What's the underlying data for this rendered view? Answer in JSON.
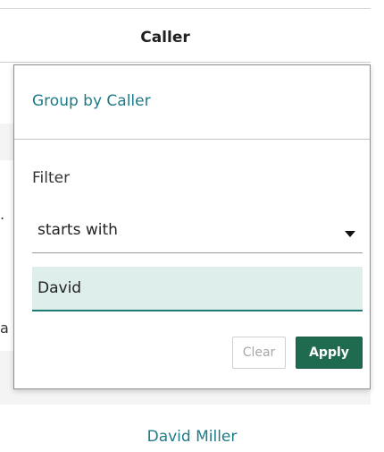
{
  "table": {
    "column_header": "Caller",
    "edge_glyph_dot": ".",
    "edge_glyph_a": "a",
    "visible_value_link": "David Miller"
  },
  "popover": {
    "title": "Group by Caller",
    "filter_label": "Filter",
    "condition": {
      "selected": "starts with",
      "icon": "caret-down-icon"
    },
    "input_value": "David",
    "clear_label": "Clear",
    "apply_label": "Apply"
  },
  "colors": {
    "link_teal": "#1d7a87",
    "input_fill": "#deeeeb",
    "input_underline": "#1e7a72",
    "apply_green": "#1e6b4f"
  }
}
